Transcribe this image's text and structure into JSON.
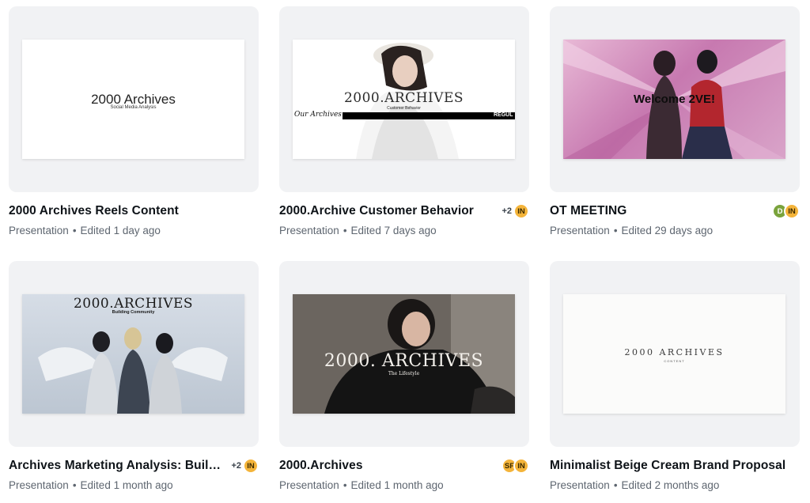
{
  "designs": [
    {
      "title": "2000 Archives Reels Content",
      "type": "Presentation",
      "edited": "Edited 1 day ago",
      "thumb": {
        "heading": "2000 Archives",
        "sub": "Social Media Analysis"
      },
      "collaborators": {
        "plus": "",
        "avatars": []
      }
    },
    {
      "title": "2000.Archive Customer Behavior",
      "type": "Presentation",
      "edited": "Edited 7 days ago",
      "thumb": {
        "heading": "2000.ARCHIVES",
        "sub": "Customer Behavior",
        "script": "Our Archives",
        "banner": "REGUL"
      },
      "collaborators": {
        "plus": "+2",
        "avatars": [
          {
            "initials": "IN",
            "color": "#f4b43a"
          }
        ]
      }
    },
    {
      "title": "OT MEETING",
      "type": "Presentation",
      "edited": "Edited 29 days ago",
      "thumb": {
        "heading": "Welcome 2VE!"
      },
      "collaborators": {
        "plus": "",
        "avatars": [
          {
            "initials": "D",
            "color": "#7aa33c"
          },
          {
            "initials": "IN",
            "color": "#f4b43a"
          }
        ]
      }
    },
    {
      "title": "Archives Marketing Analysis: Building Community",
      "type": "Presentation",
      "edited": "Edited 1 month ago",
      "thumb": {
        "heading": "2000.ARCHIVES",
        "sub": "Building Community"
      },
      "collaborators": {
        "plus": "+2",
        "avatars": [
          {
            "initials": "IN",
            "color": "#f4b43a"
          }
        ]
      }
    },
    {
      "title": "2000.Archives",
      "type": "Presentation",
      "edited": "Edited 1 month ago",
      "thumb": {
        "heading": "2000. ARCHIVES",
        "sub": "The Lifestyle"
      },
      "collaborators": {
        "plus": "",
        "avatars": [
          {
            "initials": "SF",
            "color": "#f4b43a"
          },
          {
            "initials": "IN",
            "color": "#f4b43a"
          }
        ]
      }
    },
    {
      "title": "Minimalist Beige Cream Brand Proposal",
      "type": "Presentation",
      "edited": "Edited 2 months ago",
      "thumb": {
        "heading": "2000 ARCHIVES",
        "sub": "CONTENT"
      },
      "collaborators": {
        "plus": "",
        "avatars": []
      }
    }
  ],
  "meta_separator": "•"
}
